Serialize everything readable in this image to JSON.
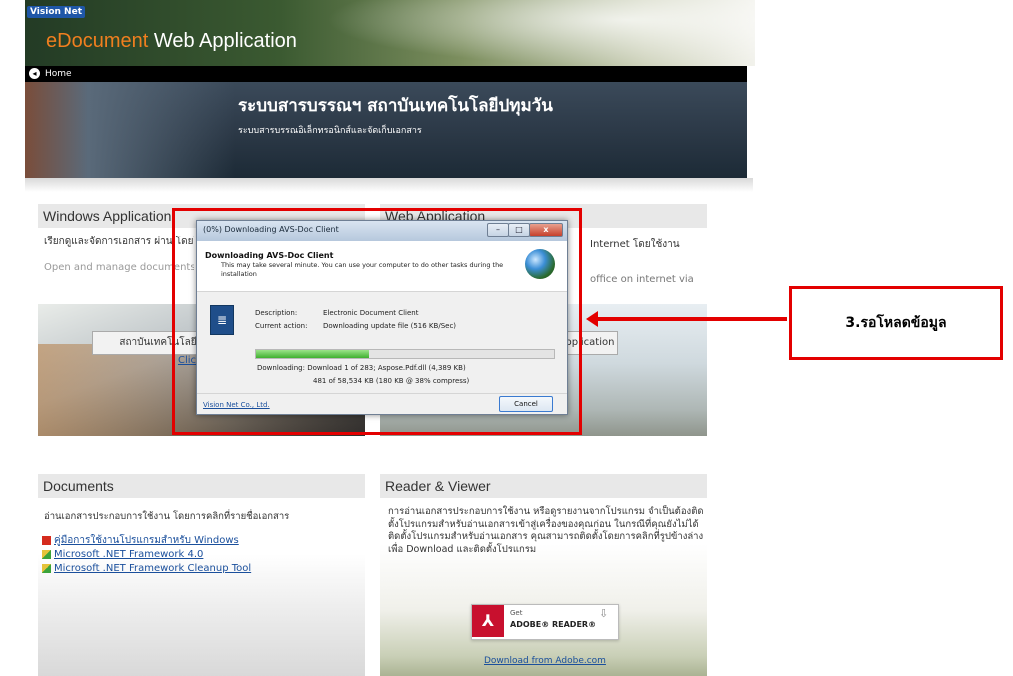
{
  "header": {
    "logo_text": "Vision Net",
    "app_title_accent": "eDocument",
    "app_title_rest": " Web Application",
    "home_label": "Home",
    "banner_title": "ระบบสารบรรณฯ สถาบันเทคโนโลยีปทุมวัน",
    "banner_subtitle": "ระบบสารบรรณอิเล็กทรอนิกส์และจัดเก็บเอกสาร"
  },
  "windows_panel": {
    "title": "Windows Application",
    "desc_th": "เรียกดูและจัดการเอกสาร ผ่าน โดยใช้โปรแกรมบนระบบปฏิบัติ",
    "desc_en": "Open and manage documents network by Windows Application",
    "button_label": "สถาบันเทคโนโลยี",
    "link_label": "Click here"
  },
  "web_panel": {
    "title": "Web Application",
    "desc_th": "Internet โดยใช้งาน",
    "desc_en": "office on internet via",
    "button_label": "Application"
  },
  "dialog": {
    "title": "(0%) Downloading AVS-Doc Client",
    "heading": "Downloading AVS-Doc Client",
    "note": "This may take several minute. You can use your computer to do other tasks during the installation",
    "description_label": "Description:",
    "description_value": "Electronic Document Client",
    "action_label": "Current action:",
    "action_value": "Downloading update file (516 KB/Sec)",
    "progress_percent": 38,
    "download_line1": "Downloading:  Download 1 of 283; Aspose.Pdf.dll (4,389 KB)",
    "download_line2": "481 of 58,534 KB (180 KB @ 38% compress)",
    "company_link": "Vision Net Co., Ltd.",
    "cancel_label": "Cancel",
    "min_glyph": "–",
    "max_glyph": "□",
    "close_glyph": "x"
  },
  "callout": {
    "text": "3.รอโหลดข้อมูล",
    "color": "#e30000"
  },
  "documents_panel": {
    "title": "Documents",
    "desc": "อ่านเอกสารประกอบการใช้งาน โดยการคลิกที่รายชื่อเอกสาร",
    "items": [
      {
        "label": "คู่มือการใช้งานโปรแกรมสำหรับ Windows",
        "icon": "pdf-icon"
      },
      {
        "label": "Microsoft .NET Framework 4.0",
        "icon": "download-icon"
      },
      {
        "label": "Microsoft .NET Framework Cleanup Tool",
        "icon": "download-icon"
      }
    ]
  },
  "reader_panel": {
    "title": "Reader & Viewer",
    "desc": "การอ่านเอกสารประกอบการใช้งาน หรือดูรายงานจากโปรแกรม จำเป็นต้องติดตั้งโปรแกรมสำหรับอ่านเอกสารเข้าสู่เครื่องของคุณก่อน ในกรณีที่คุณยังไม่ได้ติดตั้งโปรแกรมสำหรับอ่านเอกสาร คุณสามารถติดตั้งโดยการคลิกที่รูปข้างล่างเพื่อ Download และติดตั้งโปรแกรม",
    "adobe_get": "Get",
    "adobe_name": "ADOBE® READER®",
    "adobe_link": "Download from Adobe.com"
  }
}
